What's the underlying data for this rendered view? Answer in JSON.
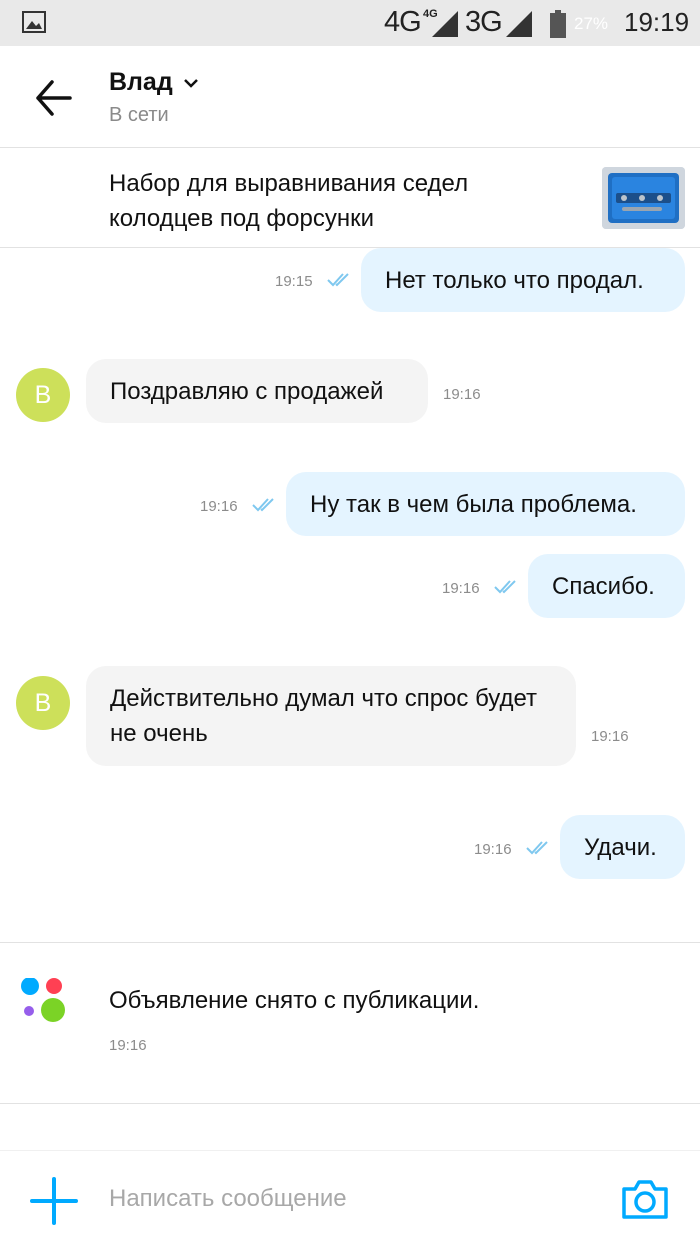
{
  "status_bar": {
    "network_1": "4G",
    "network_1_small": "4G",
    "network_2": "3G",
    "battery": "27%",
    "time": "19:19"
  },
  "header": {
    "contact_name": "Влад",
    "contact_status": "В сети"
  },
  "ad": {
    "title": "Набор для выравнивания седел колодцев под форсунки"
  },
  "messages": [
    {
      "direction": "out",
      "text": "Нет только что продал.",
      "time": "19:15",
      "read": true
    },
    {
      "direction": "in",
      "avatar": "В",
      "text": "Поздравляю с продажей",
      "time": "19:16"
    },
    {
      "direction": "out",
      "text": "Ну так в чем была проблема.",
      "time": "19:16",
      "read": true
    },
    {
      "direction": "out",
      "text": "Спасибо.",
      "time": "19:16",
      "read": true
    },
    {
      "direction": "in",
      "avatar": "В",
      "text": "Действительно думал что спрос будет не очень",
      "time": "19:16"
    },
    {
      "direction": "out",
      "text": "Удачи.",
      "time": "19:16",
      "read": true
    }
  ],
  "notice": {
    "text": "Объявление снято с публикации.",
    "time": "19:16"
  },
  "composer": {
    "placeholder": "Написать сообщение"
  },
  "colors": {
    "accent": "#00aaff",
    "outgoing_bubble": "#e4f4ff",
    "incoming_bubble": "#f4f4f4",
    "avatar": "#cde05a"
  }
}
